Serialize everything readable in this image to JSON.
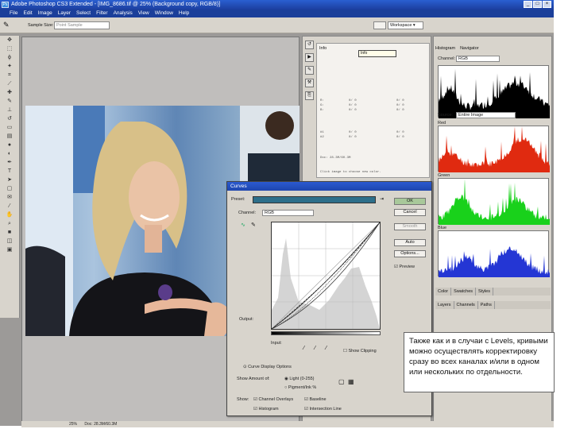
{
  "window": {
    "title": "Adobe Photoshop CS3 Extended - [IMG_8686.tif @ 25% (Background copy, RGB/8)]",
    "app_icon": "Ps"
  },
  "menu": [
    "File",
    "Edit",
    "Image",
    "Layer",
    "Select",
    "Filter",
    "Analysis",
    "View",
    "Window",
    "Help"
  ],
  "options_bar": {
    "sample_size_label": "Sample Size:",
    "sample_size_value": "Point Sample",
    "workspace_label": "Workspace ▾"
  },
  "info_panel": {
    "tab": "Info",
    "tooltip": "Info"
  },
  "histogram_panel": {
    "tabs": [
      "Histogram",
      "Navigator"
    ],
    "channel_label": "Channel:",
    "channel_value": "RGB",
    "source_label": "Source:",
    "source_value": "Entire Image",
    "red_label": "Red",
    "green_label": "Green",
    "blue_label": "Blue",
    "colors": {
      "rgb": "#000000",
      "red": "#e02a10",
      "green": "#19d11b",
      "blue": "#2436d4"
    }
  },
  "lower_panels": {
    "tabs1": [
      "Color",
      "Swatches",
      "Styles"
    ],
    "tabs2": [
      "Layers",
      "Channels",
      "Paths"
    ]
  },
  "curves_dialog": {
    "title": "Curves",
    "preset_label": "Preset:",
    "channel_label": "Channel:",
    "channel_value": "RGB",
    "output_label": "Output:",
    "input_label": "Input:",
    "show_clipping_label": "Show Clipping",
    "display_options_label": "Curve Display Options",
    "show_amount_label": "Show Amount of:",
    "light_option": "Light (0-255)",
    "pigment_option": "Pigment/Ink %",
    "show_label": "Show:",
    "show_options": [
      "Channel Overlays",
      "Baseline",
      "Histogram",
      "Intersection Line"
    ],
    "buttons": [
      "OK",
      "Cancel",
      "Smooth",
      "Auto",
      "Options...",
      "Preview"
    ]
  },
  "status_bar": {
    "zoom": "25%",
    "doc_size": "Doc: 28.3M/60.3M"
  },
  "note": "Также как и в случаи с Levels, кривыми можно осуществлять корректировку сразу во всех каналах и/или в одном или нескольких по отдельности."
}
